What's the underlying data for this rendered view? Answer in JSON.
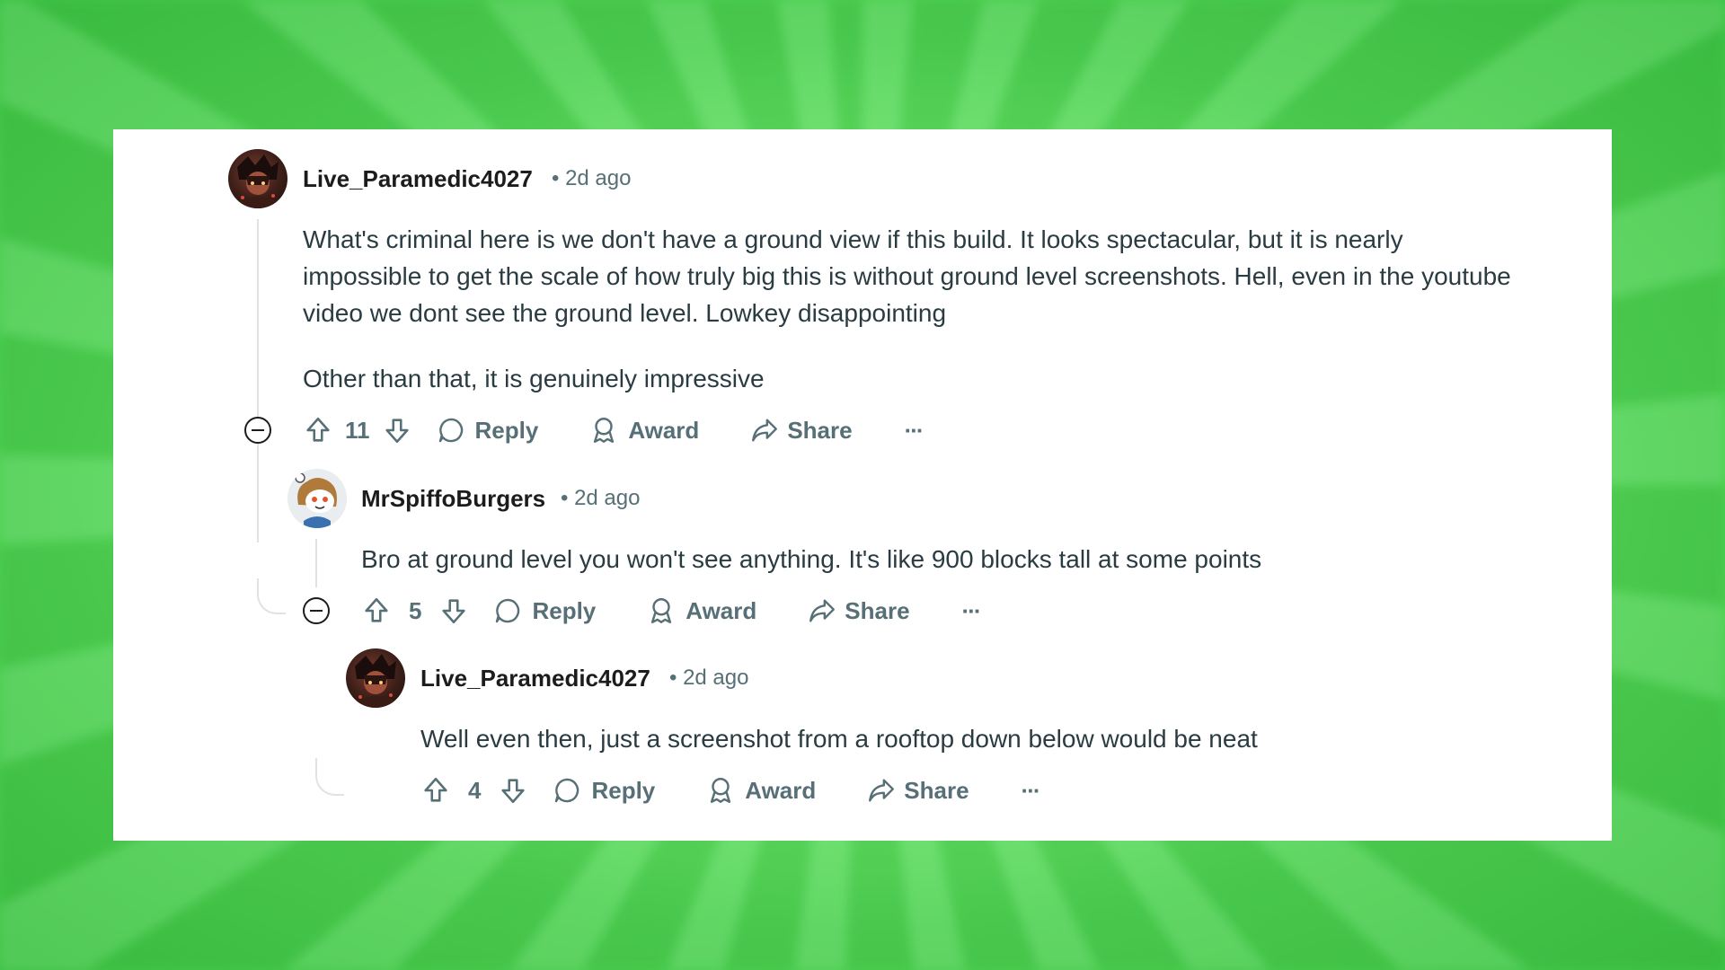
{
  "comments": [
    {
      "username": "Live_Paramedic4027",
      "time": "• 2d ago",
      "paragraphs": [
        "What's criminal here is we don't have a ground view if this build. It looks spectacular, but it is nearly impossible to get the scale of how truly big this is without ground level screenshots. Hell, even in the youtube video we dont see the ground level. Lowkey disappointing",
        "Other than that, it is genuinely impressive"
      ],
      "score": "11",
      "reply_label": "Reply",
      "award_label": "Award",
      "share_label": "Share",
      "more_label": "···"
    },
    {
      "username": "MrSpiffoBurgers",
      "time": "• 2d ago",
      "paragraphs": [
        "Bro at ground level you won't see anything. It's like 900 blocks tall at some points"
      ],
      "score": "5",
      "reply_label": "Reply",
      "award_label": "Award",
      "share_label": "Share",
      "more_label": "···"
    },
    {
      "username": "Live_Paramedic4027",
      "time": "• 2d ago",
      "paragraphs": [
        "Well even then, just a screenshot from a rooftop down below would be neat"
      ],
      "score": "4",
      "reply_label": "Reply",
      "award_label": "Award",
      "share_label": "Share",
      "more_label": "···"
    }
  ],
  "colors": {
    "text_primary": "#2a3c42",
    "text_secondary": "#576f76",
    "background_green": "#6fe96f"
  }
}
